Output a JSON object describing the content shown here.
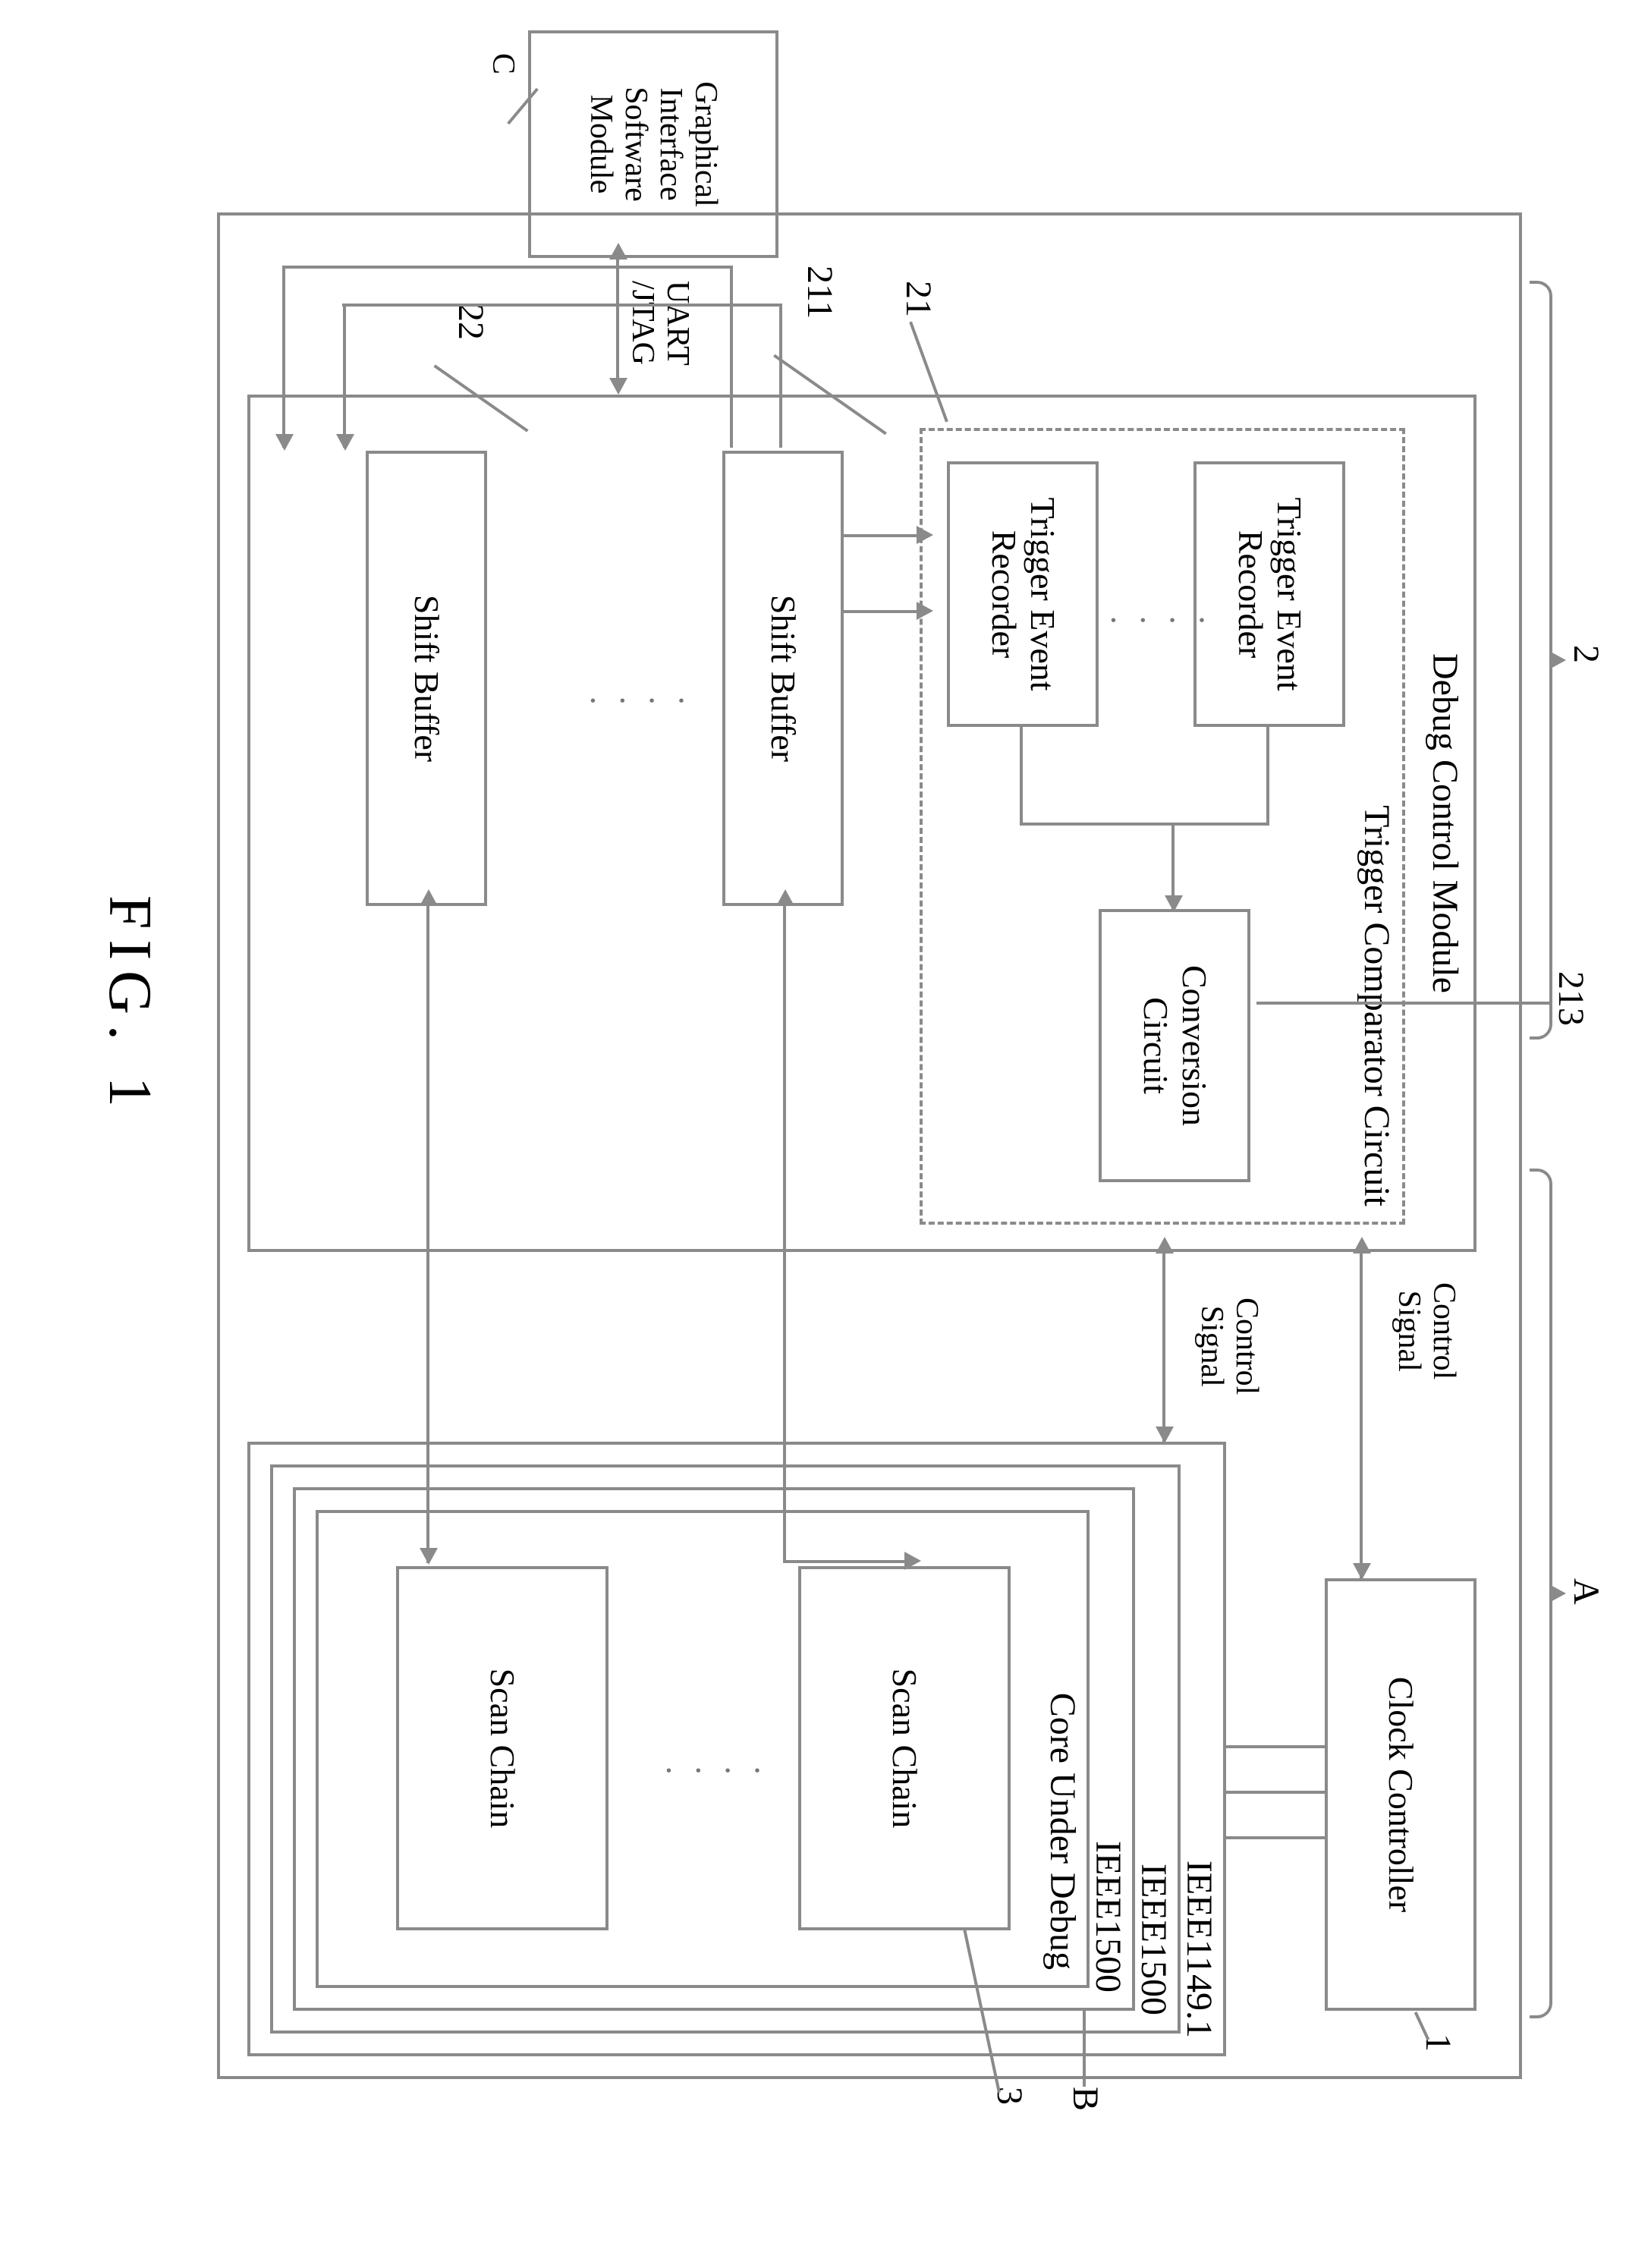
{
  "figure_label": "FIG. 1",
  "external": {
    "gism": "Graphical\nInterface\nSoftware\nModule",
    "uart_jtag": "UART\n/JTAG"
  },
  "chip_label_A": "A",
  "clock_controller": "Clock Controller",
  "clock_ref": "1",
  "control_signal": "Control\nSignal",
  "debug_module": {
    "title": "Debug Control Module",
    "ref": "2",
    "trigger_circuit": {
      "title": "Trigger Comparator Circuit",
      "ref": "21",
      "trigger_event_recorder": "Trigger Event\nRecorder",
      "ter_ref": "211",
      "conversion_circuit": "Conversion\nCircuit",
      "conv_ref": "213"
    },
    "shift_buffer": "Shift Buffer",
    "sb_ref": "22"
  },
  "wrappers": {
    "outer": "IEEE1149.1",
    "mid": "IEEE1500",
    "inner": "IEEE1500",
    "core": "Core Under Debug",
    "scan_chain": "Scan Chain",
    "B_ref": "B",
    "sc_ref": "3"
  }
}
